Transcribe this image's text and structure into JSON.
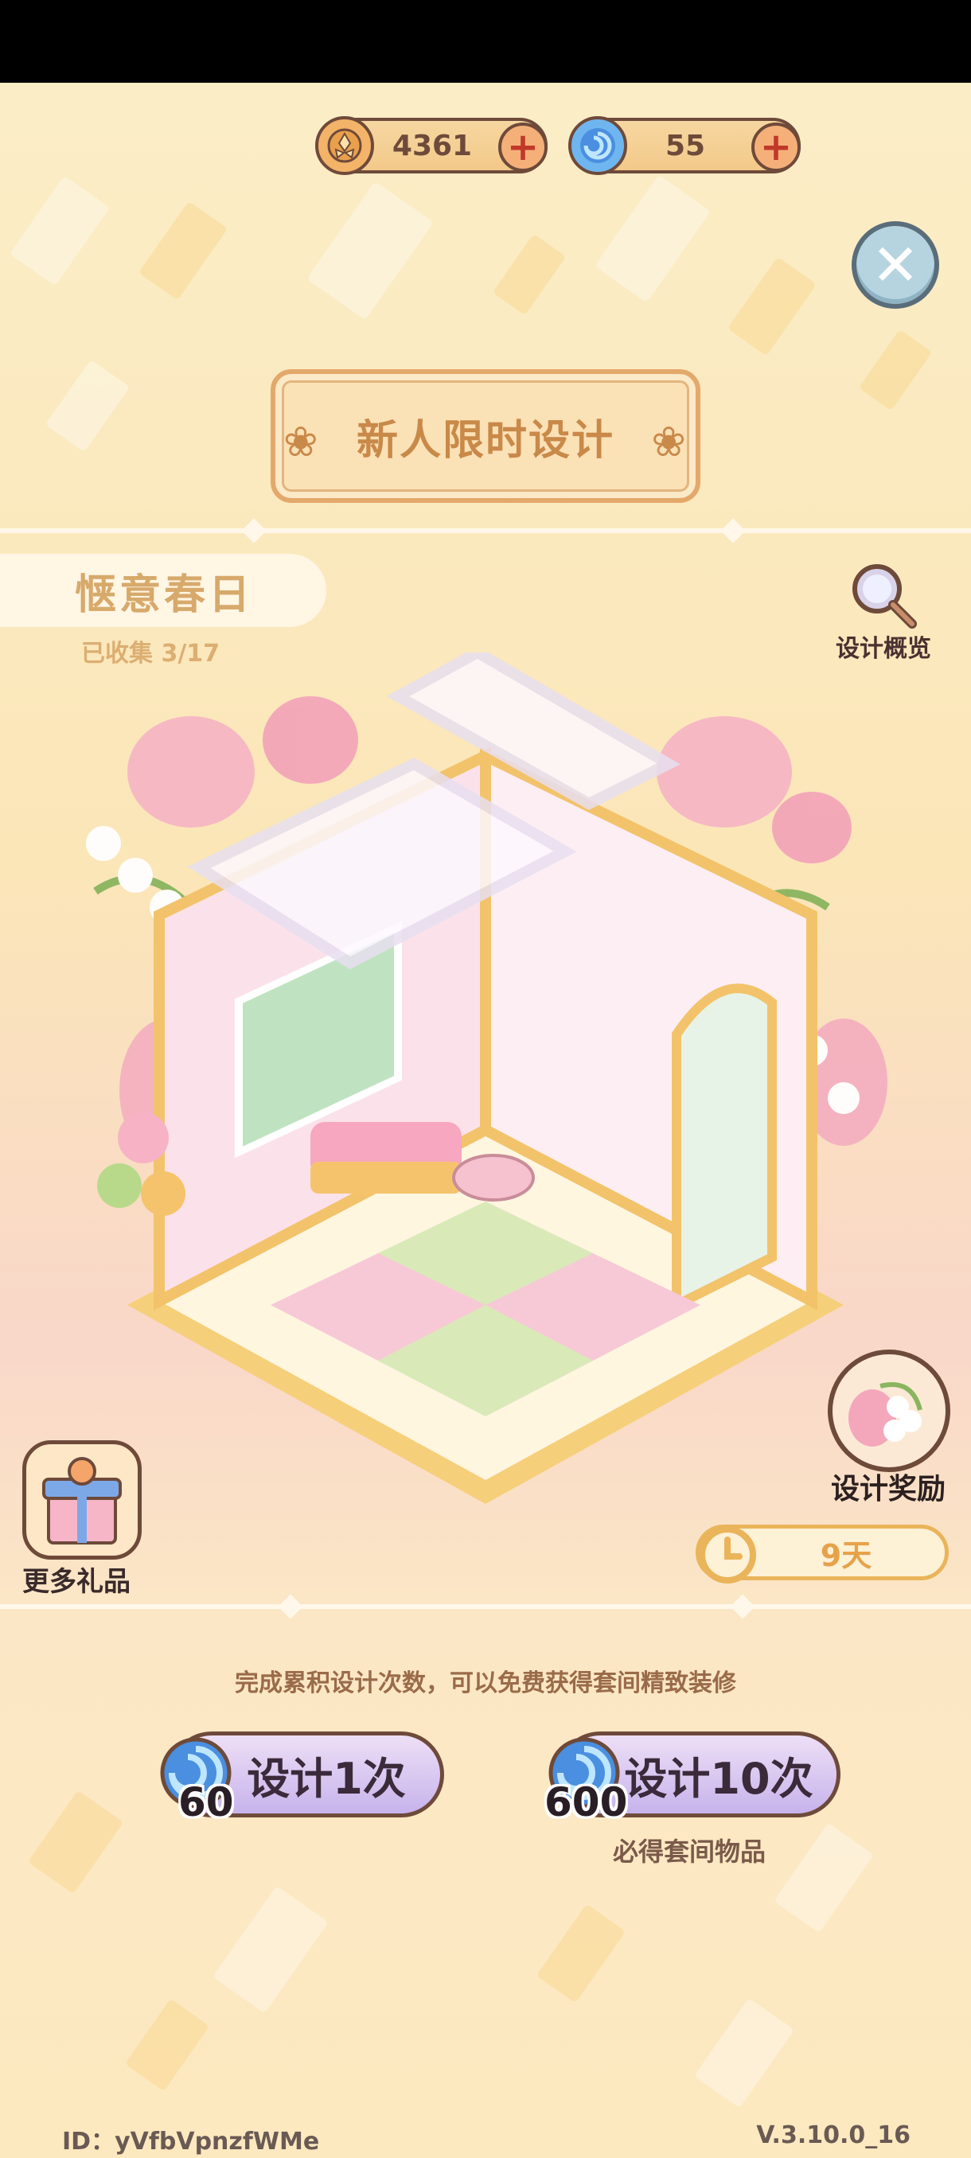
{
  "currency": {
    "coins": {
      "value": "4361",
      "icon": "coin-icon"
    },
    "orbs": {
      "value": "55",
      "icon": "blue-orb-icon"
    }
  },
  "title": "新人限时设计",
  "theme": {
    "name": "惬意春日",
    "collected": "已收集 3/17"
  },
  "overview_label": "设计概览",
  "more_gifts_label": "更多礼品",
  "reward_label": "设计奖励",
  "timer": "9天",
  "hint": "完成累积设计次数，可以免费获得套间精致装修",
  "design_once": {
    "label": "设计1次",
    "cost": "60"
  },
  "design_ten": {
    "label": "设计10次",
    "cost": "600",
    "note": "必得套间物品"
  },
  "footer": {
    "id": "ID：yVfbVpnzfWMe",
    "version": "V.3.10.0_16"
  },
  "colors": {
    "accent": "#e4a86b",
    "outline": "#6e4a3a",
    "button": "#c7b3ec"
  }
}
